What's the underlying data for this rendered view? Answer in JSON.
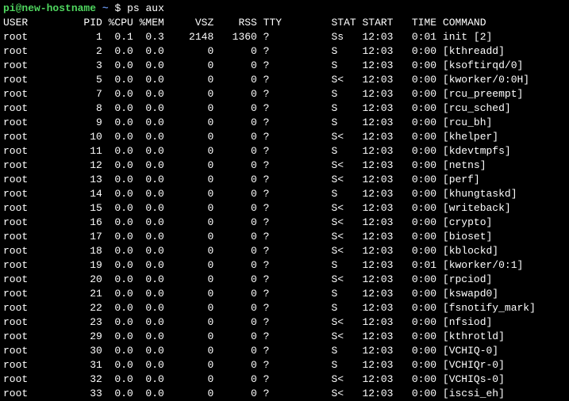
{
  "prompt": {
    "user_host": "pi@new-hostname",
    "path": "~",
    "symbol": "$",
    "command": "ps aux"
  },
  "headers": {
    "user": "USER",
    "pid": "PID",
    "cpu": "%CPU",
    "mem": "%MEM",
    "vsz": "VSZ",
    "rss": "RSS",
    "tty": "TTY",
    "stat": "STAT",
    "start": "START",
    "time": "TIME",
    "command": "COMMAND"
  },
  "rows": [
    {
      "user": "root",
      "pid": "1",
      "cpu": "0.1",
      "mem": "0.3",
      "vsz": "2148",
      "rss": "1360",
      "tty": "?",
      "stat": "Ss",
      "start": "12:03",
      "time": "0:01",
      "command": "init [2]"
    },
    {
      "user": "root",
      "pid": "2",
      "cpu": "0.0",
      "mem": "0.0",
      "vsz": "0",
      "rss": "0",
      "tty": "?",
      "stat": "S",
      "start": "12:03",
      "time": "0:00",
      "command": "[kthreadd]"
    },
    {
      "user": "root",
      "pid": "3",
      "cpu": "0.0",
      "mem": "0.0",
      "vsz": "0",
      "rss": "0",
      "tty": "?",
      "stat": "S",
      "start": "12:03",
      "time": "0:00",
      "command": "[ksoftirqd/0]"
    },
    {
      "user": "root",
      "pid": "5",
      "cpu": "0.0",
      "mem": "0.0",
      "vsz": "0",
      "rss": "0",
      "tty": "?",
      "stat": "S<",
      "start": "12:03",
      "time": "0:00",
      "command": "[kworker/0:0H]"
    },
    {
      "user": "root",
      "pid": "7",
      "cpu": "0.0",
      "mem": "0.0",
      "vsz": "0",
      "rss": "0",
      "tty": "?",
      "stat": "S",
      "start": "12:03",
      "time": "0:00",
      "command": "[rcu_preempt]"
    },
    {
      "user": "root",
      "pid": "8",
      "cpu": "0.0",
      "mem": "0.0",
      "vsz": "0",
      "rss": "0",
      "tty": "?",
      "stat": "S",
      "start": "12:03",
      "time": "0:00",
      "command": "[rcu_sched]"
    },
    {
      "user": "root",
      "pid": "9",
      "cpu": "0.0",
      "mem": "0.0",
      "vsz": "0",
      "rss": "0",
      "tty": "?",
      "stat": "S",
      "start": "12:03",
      "time": "0:00",
      "command": "[rcu_bh]"
    },
    {
      "user": "root",
      "pid": "10",
      "cpu": "0.0",
      "mem": "0.0",
      "vsz": "0",
      "rss": "0",
      "tty": "?",
      "stat": "S<",
      "start": "12:03",
      "time": "0:00",
      "command": "[khelper]"
    },
    {
      "user": "root",
      "pid": "11",
      "cpu": "0.0",
      "mem": "0.0",
      "vsz": "0",
      "rss": "0",
      "tty": "?",
      "stat": "S",
      "start": "12:03",
      "time": "0:00",
      "command": "[kdevtmpfs]"
    },
    {
      "user": "root",
      "pid": "12",
      "cpu": "0.0",
      "mem": "0.0",
      "vsz": "0",
      "rss": "0",
      "tty": "?",
      "stat": "S<",
      "start": "12:03",
      "time": "0:00",
      "command": "[netns]"
    },
    {
      "user": "root",
      "pid": "13",
      "cpu": "0.0",
      "mem": "0.0",
      "vsz": "0",
      "rss": "0",
      "tty": "?",
      "stat": "S<",
      "start": "12:03",
      "time": "0:00",
      "command": "[perf]"
    },
    {
      "user": "root",
      "pid": "14",
      "cpu": "0.0",
      "mem": "0.0",
      "vsz": "0",
      "rss": "0",
      "tty": "?",
      "stat": "S",
      "start": "12:03",
      "time": "0:00",
      "command": "[khungtaskd]"
    },
    {
      "user": "root",
      "pid": "15",
      "cpu": "0.0",
      "mem": "0.0",
      "vsz": "0",
      "rss": "0",
      "tty": "?",
      "stat": "S<",
      "start": "12:03",
      "time": "0:00",
      "command": "[writeback]"
    },
    {
      "user": "root",
      "pid": "16",
      "cpu": "0.0",
      "mem": "0.0",
      "vsz": "0",
      "rss": "0",
      "tty": "?",
      "stat": "S<",
      "start": "12:03",
      "time": "0:00",
      "command": "[crypto]"
    },
    {
      "user": "root",
      "pid": "17",
      "cpu": "0.0",
      "mem": "0.0",
      "vsz": "0",
      "rss": "0",
      "tty": "?",
      "stat": "S<",
      "start": "12:03",
      "time": "0:00",
      "command": "[bioset]"
    },
    {
      "user": "root",
      "pid": "18",
      "cpu": "0.0",
      "mem": "0.0",
      "vsz": "0",
      "rss": "0",
      "tty": "?",
      "stat": "S<",
      "start": "12:03",
      "time": "0:00",
      "command": "[kblockd]"
    },
    {
      "user": "root",
      "pid": "19",
      "cpu": "0.0",
      "mem": "0.0",
      "vsz": "0",
      "rss": "0",
      "tty": "?",
      "stat": "S",
      "start": "12:03",
      "time": "0:01",
      "command": "[kworker/0:1]"
    },
    {
      "user": "root",
      "pid": "20",
      "cpu": "0.0",
      "mem": "0.0",
      "vsz": "0",
      "rss": "0",
      "tty": "?",
      "stat": "S<",
      "start": "12:03",
      "time": "0:00",
      "command": "[rpciod]"
    },
    {
      "user": "root",
      "pid": "21",
      "cpu": "0.0",
      "mem": "0.0",
      "vsz": "0",
      "rss": "0",
      "tty": "?",
      "stat": "S",
      "start": "12:03",
      "time": "0:00",
      "command": "[kswapd0]"
    },
    {
      "user": "root",
      "pid": "22",
      "cpu": "0.0",
      "mem": "0.0",
      "vsz": "0",
      "rss": "0",
      "tty": "?",
      "stat": "S",
      "start": "12:03",
      "time": "0:00",
      "command": "[fsnotify_mark]"
    },
    {
      "user": "root",
      "pid": "23",
      "cpu": "0.0",
      "mem": "0.0",
      "vsz": "0",
      "rss": "0",
      "tty": "?",
      "stat": "S<",
      "start": "12:03",
      "time": "0:00",
      "command": "[nfsiod]"
    },
    {
      "user": "root",
      "pid": "29",
      "cpu": "0.0",
      "mem": "0.0",
      "vsz": "0",
      "rss": "0",
      "tty": "?",
      "stat": "S<",
      "start": "12:03",
      "time": "0:00",
      "command": "[kthrotld]"
    },
    {
      "user": "root",
      "pid": "30",
      "cpu": "0.0",
      "mem": "0.0",
      "vsz": "0",
      "rss": "0",
      "tty": "?",
      "stat": "S",
      "start": "12:03",
      "time": "0:00",
      "command": "[VCHIQ-0]"
    },
    {
      "user": "root",
      "pid": "31",
      "cpu": "0.0",
      "mem": "0.0",
      "vsz": "0",
      "rss": "0",
      "tty": "?",
      "stat": "S",
      "start": "12:03",
      "time": "0:00",
      "command": "[VCHIQr-0]"
    },
    {
      "user": "root",
      "pid": "32",
      "cpu": "0.0",
      "mem": "0.0",
      "vsz": "0",
      "rss": "0",
      "tty": "?",
      "stat": "S<",
      "start": "12:03",
      "time": "0:00",
      "command": "[VCHIQs-0]"
    },
    {
      "user": "root",
      "pid": "33",
      "cpu": "0.0",
      "mem": "0.0",
      "vsz": "0",
      "rss": "0",
      "tty": "?",
      "stat": "S<",
      "start": "12:03",
      "time": "0:00",
      "command": "[iscsi_eh]"
    }
  ]
}
